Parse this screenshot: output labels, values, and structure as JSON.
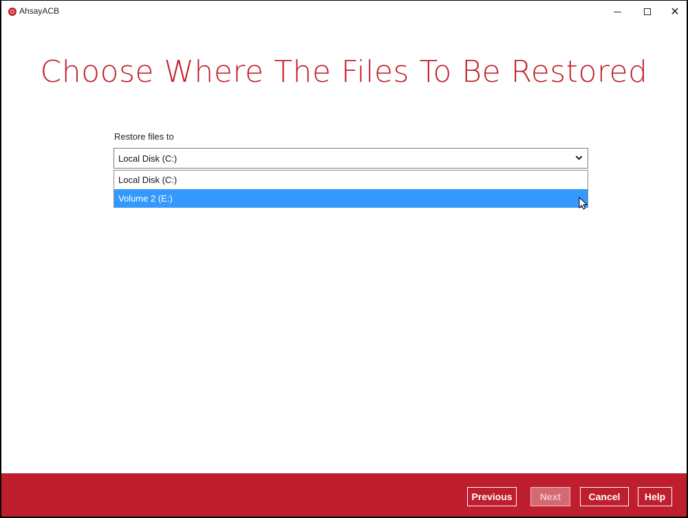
{
  "window": {
    "title": "AhsayACB",
    "icons": {
      "logo": "ahsay-logo-icon",
      "minimize": "minimize-icon",
      "maximize": "maximize-icon",
      "close": "close-icon"
    },
    "close_glyph": "✕"
  },
  "heading": "Choose Where The Files To Be Restored",
  "restore": {
    "label": "Restore files to",
    "selected": "Local Disk (C:)",
    "options": [
      "Local Disk (C:)",
      "Volume 2 (E:)"
    ],
    "highlighted_option": "Volume 2 (E:)"
  },
  "footer": {
    "previous_label": "Previous",
    "next_label": "Next",
    "cancel_label": "Cancel",
    "help_label": "Help"
  },
  "colors": {
    "accent": "#be1e2d",
    "selection": "#3399ff"
  }
}
